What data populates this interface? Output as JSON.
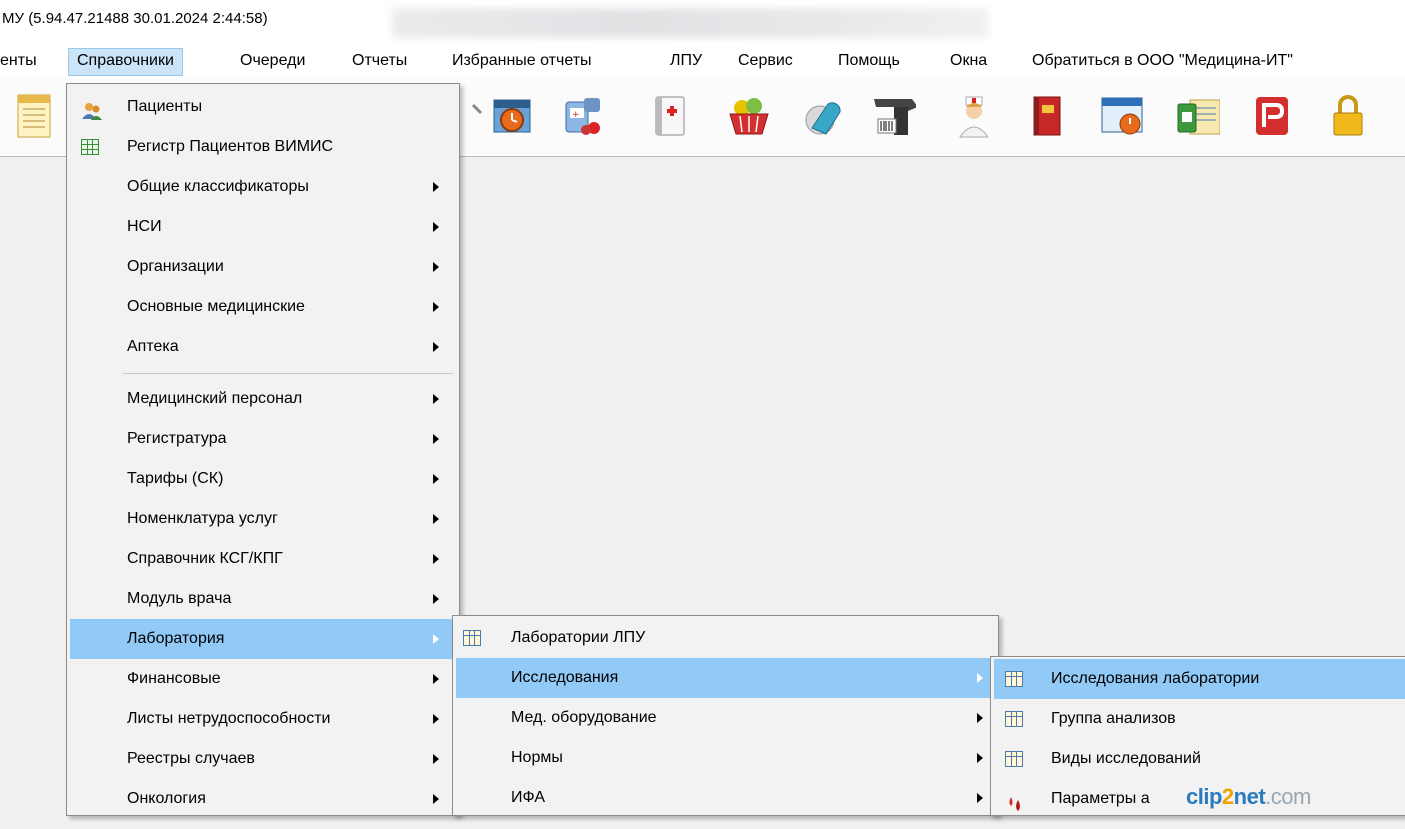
{
  "window": {
    "title": "МУ (5.94.47.21488 30.01.2024 2:44:58)"
  },
  "menubar": {
    "items": [
      {
        "label": "енты"
      },
      {
        "label": "Справочники"
      },
      {
        "label": "Очереди"
      },
      {
        "label": "Отчеты"
      },
      {
        "label": "Избранные отчеты"
      },
      {
        "label": "ЛПУ"
      },
      {
        "label": "Сервис"
      },
      {
        "label": "Помощь"
      },
      {
        "label": "Окна"
      },
      {
        "label": "Обратиться в ООО \"Медицина-ИТ\""
      }
    ]
  },
  "toolbar": {
    "icons": [
      "document-icon",
      "calendar-clock-icon",
      "pills-icon",
      "medical-kit-icon",
      "food-basket-icon",
      "tablets-icon",
      "barcode-scanner-icon",
      "nurse-icon",
      "red-book-icon",
      "schedule-icon",
      "id-card-icon",
      "pdf-icon",
      "lock-icon"
    ]
  },
  "menu_main": {
    "items": [
      {
        "label": "Пациенты",
        "icon": "patients-icon"
      },
      {
        "label": "Регистр Пациентов ВИМИС",
        "icon": "grid-icon"
      },
      {
        "label": "Общие классификаторы",
        "submenu": true
      },
      {
        "label": "НСИ",
        "submenu": true
      },
      {
        "label": "Организации",
        "submenu": true
      },
      {
        "label": "Основные медицинские",
        "submenu": true
      },
      {
        "label": "Аптека",
        "submenu": true
      },
      {
        "label": "Медицинский персонал",
        "submenu": true
      },
      {
        "label": "Регистратура",
        "submenu": true
      },
      {
        "label": "Тарифы (СК)",
        "submenu": true
      },
      {
        "label": "Номенклатура услуг",
        "submenu": true
      },
      {
        "label": "Справочник КСГ/КПГ",
        "submenu": true
      },
      {
        "label": "Модуль врача",
        "submenu": true
      },
      {
        "label": "Лаборатория",
        "submenu": true,
        "highlighted": true
      },
      {
        "label": "Финансовые",
        "submenu": true
      },
      {
        "label": "Листы нетрудоспособности",
        "submenu": true
      },
      {
        "label": "Реестры случаев",
        "submenu": true
      },
      {
        "label": "Онкология",
        "submenu": true
      }
    ]
  },
  "menu_lab": {
    "items": [
      {
        "label": "Лаборатории ЛПУ",
        "icon": "table-icon"
      },
      {
        "label": "Исследования",
        "submenu": true,
        "highlighted": true
      },
      {
        "label": "Мед. оборудование",
        "submenu": true
      },
      {
        "label": "Нормы",
        "submenu": true
      },
      {
        "label": "ИФА",
        "submenu": true
      }
    ]
  },
  "menu_research": {
    "items": [
      {
        "label": "Исследования лаборатории",
        "icon": "table-icon",
        "highlighted": true
      },
      {
        "label": "Группа анализов",
        "icon": "table-icon"
      },
      {
        "label": "Виды исследований",
        "icon": "table-icon"
      },
      {
        "label": "Параметры а",
        "icon": "blood-drop-icon"
      }
    ]
  },
  "watermark": {
    "part1": "clip",
    "part2": "2",
    "part3": "net",
    "part4": ".com"
  },
  "colors": {
    "highlight": "#91c9f7",
    "menubar_active": "#cce4f7",
    "menu_bg": "#f2f2f2"
  }
}
